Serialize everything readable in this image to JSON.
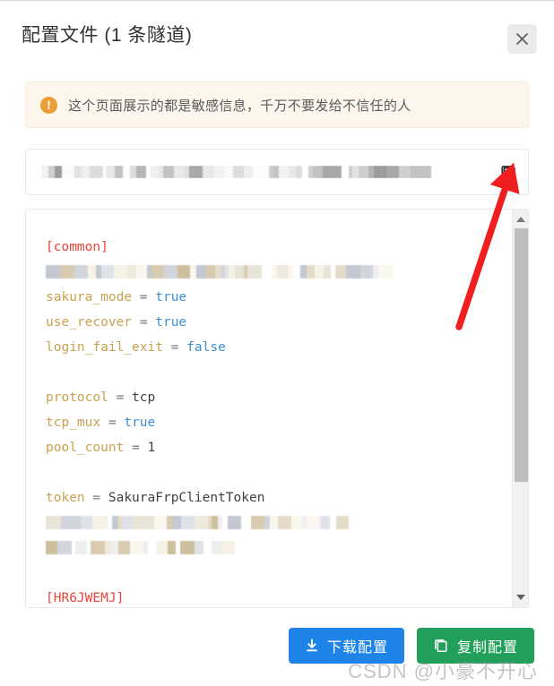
{
  "dialog": {
    "title": "配置文件 (1 条隧道)",
    "close_label": "×"
  },
  "warning": {
    "icon": "warning-exclamation-icon",
    "icon_glyph": "!",
    "text": "这个页面展示的都是敏感信息，千万不要发给不信任的人",
    "background_color": "#fdf6ec",
    "border_color": "#faecd8",
    "icon_color": "#eb9e37"
  },
  "url_field": {
    "value": "",
    "redacted": true,
    "copy_icon": "copy-icon"
  },
  "code": {
    "language": "ini",
    "lines": [
      {
        "type": "section",
        "text": "[common]"
      },
      {
        "type": "redacted",
        "text": ""
      },
      {
        "type": "pair",
        "key": "sakura_mode",
        "op": " = ",
        "value": "true",
        "value_kind": "bool"
      },
      {
        "type": "pair",
        "key": "use_recover",
        "op": " = ",
        "value": "true",
        "value_kind": "bool"
      },
      {
        "type": "pair",
        "key": "login_fail_exit",
        "op": " = ",
        "value": "false",
        "value_kind": "bool"
      },
      {
        "type": "blank",
        "text": ""
      },
      {
        "type": "pair",
        "key": "protocol",
        "op": " = ",
        "value": "tcp",
        "value_kind": "plain"
      },
      {
        "type": "pair",
        "key": "tcp_mux",
        "op": " = ",
        "value": "true",
        "value_kind": "bool"
      },
      {
        "type": "pair",
        "key": "pool_count",
        "op": " = ",
        "value": "1",
        "value_kind": "plain"
      },
      {
        "type": "blank",
        "text": ""
      },
      {
        "type": "pair",
        "key": "token",
        "op": " = ",
        "value": "SakuraFrpClientToken",
        "value_kind": "plain"
      },
      {
        "type": "redacted",
        "text": ""
      },
      {
        "type": "redacted",
        "text": ""
      },
      {
        "type": "blank",
        "text": ""
      },
      {
        "type": "section",
        "text": "[HR6JWEMJ]"
      }
    ],
    "colors": {
      "section": "#e8453c",
      "key": "#c7a252",
      "equals": "#7a7a7a",
      "bool": "#3d8fd1",
      "value": "#3f3f3f"
    }
  },
  "scrollbar": {
    "up_arrow": "scroll-up-arrow-icon",
    "down_arrow": "scroll-down-arrow-icon",
    "thumb_position_percent": 0,
    "thumb_size_percent": 70
  },
  "footer": {
    "download_button": {
      "label": "下载配置",
      "icon": "download-icon",
      "color": "#1f84e8"
    },
    "copy_button": {
      "label": "复制配置",
      "icon": "copy-icon",
      "color": "#22a05b"
    }
  },
  "annotation": {
    "type": "arrow",
    "color": "#f01e1e",
    "points_to": "copy-icon-in-url-field"
  },
  "watermark": {
    "text": "CSDN @小豪不开心"
  }
}
